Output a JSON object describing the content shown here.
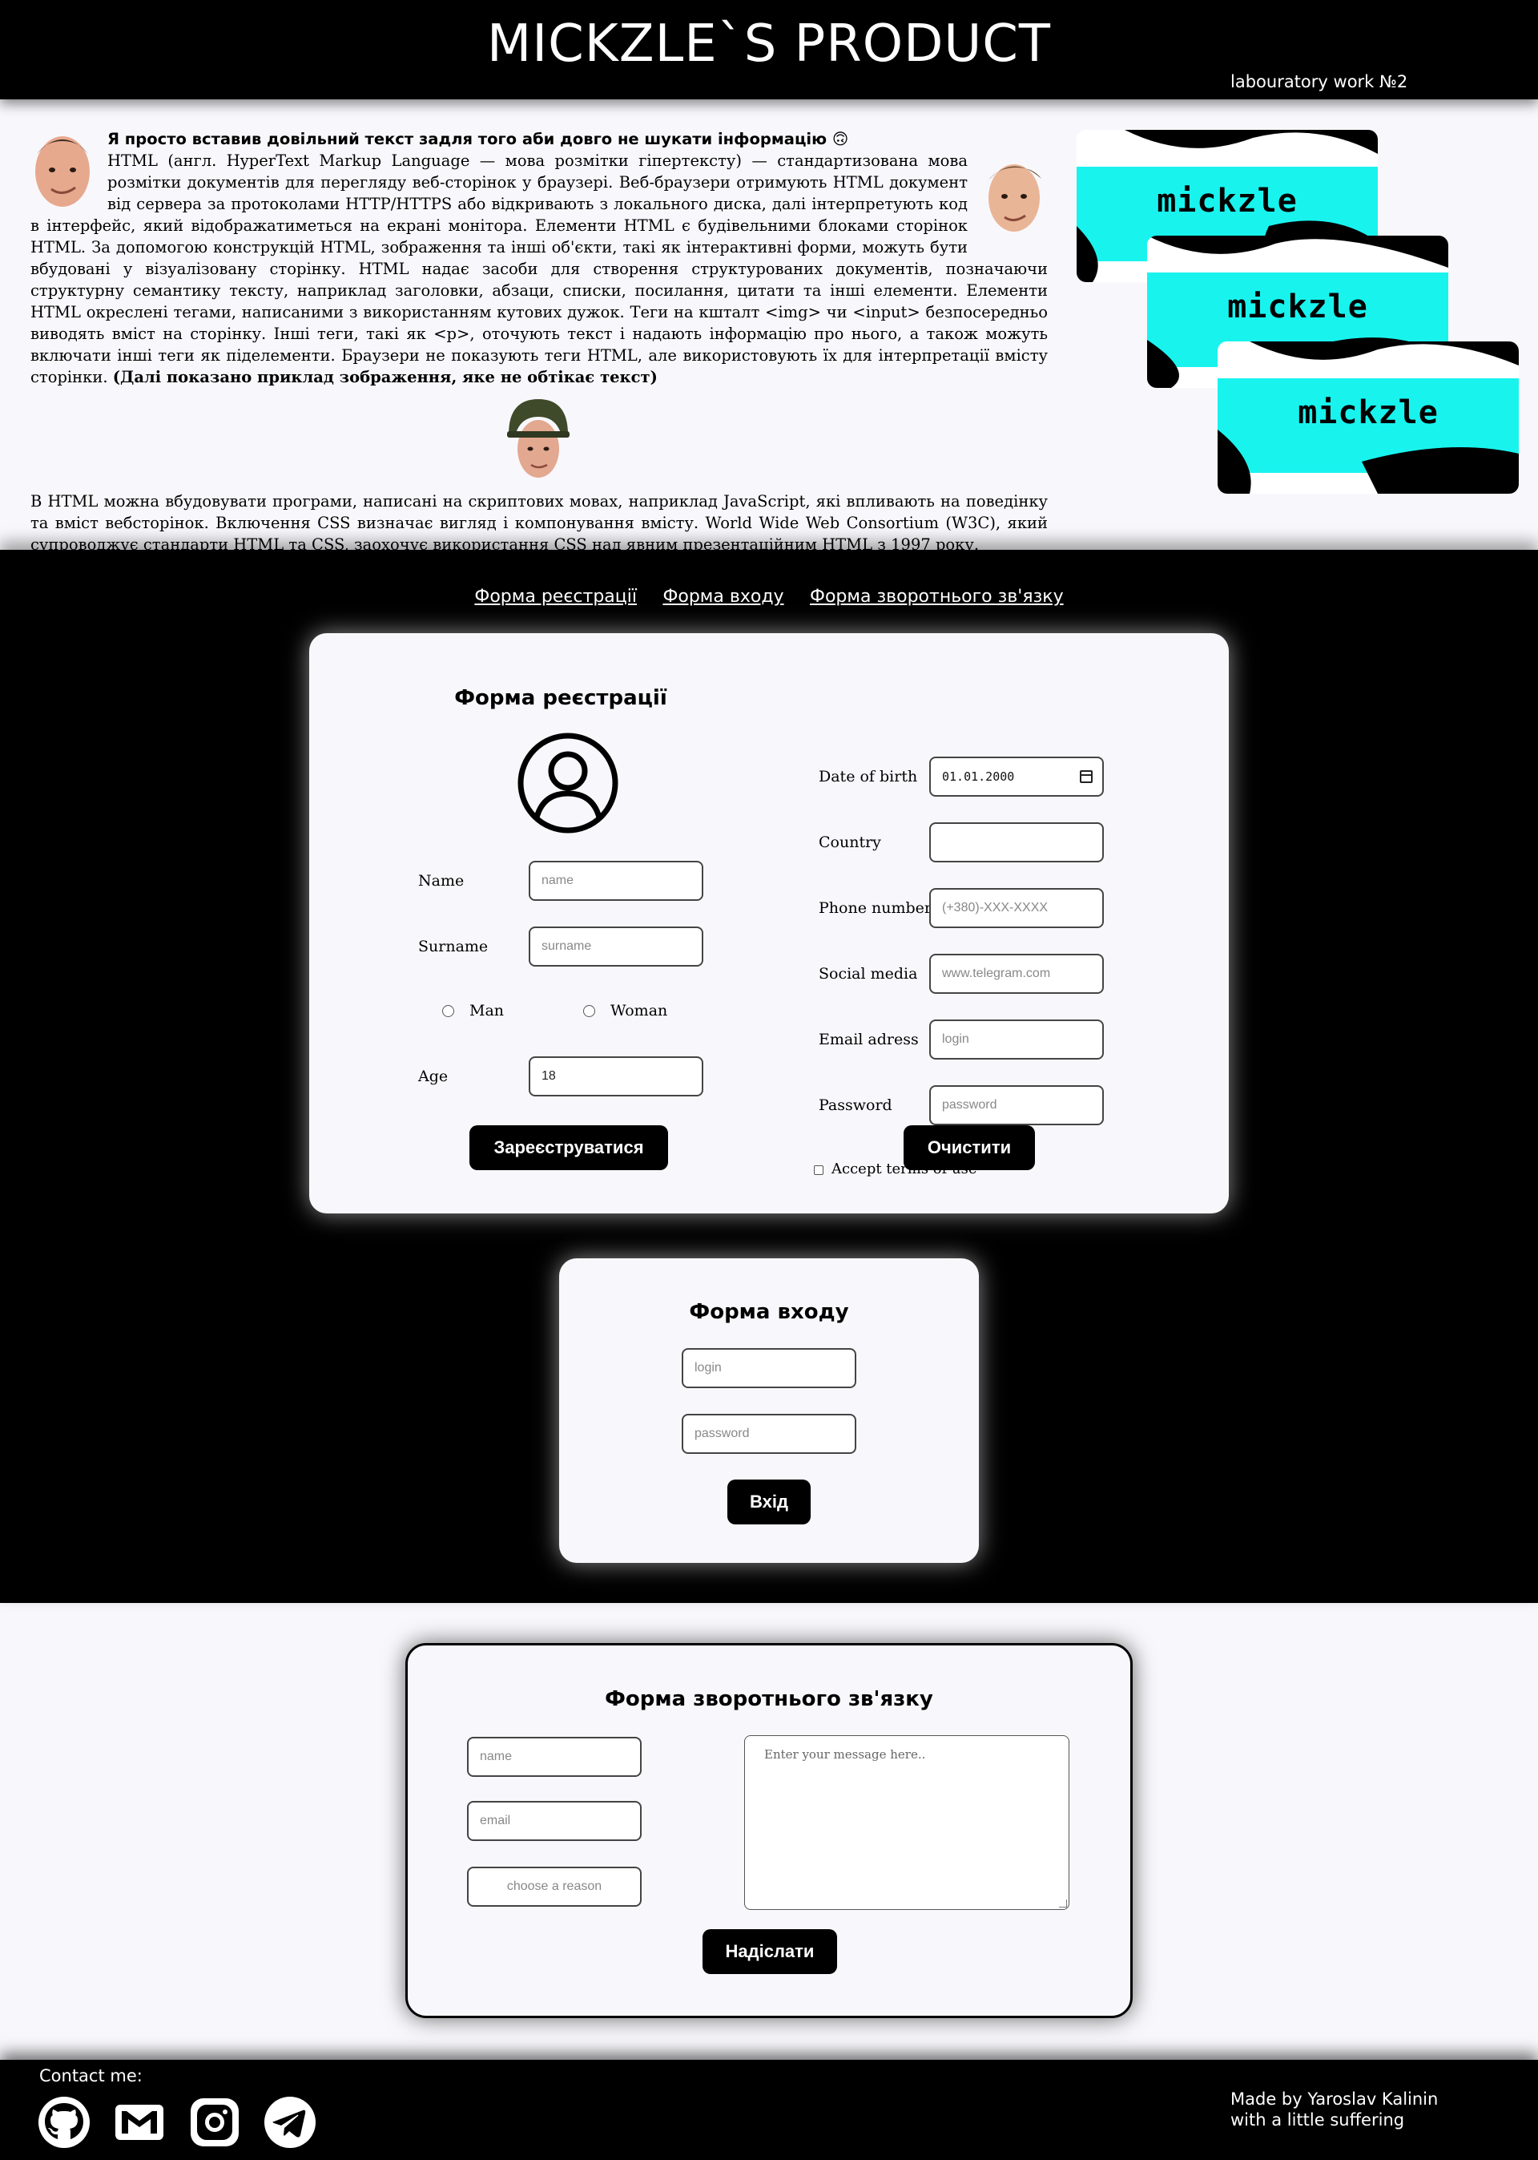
{
  "header": {
    "title": "MICKZLE`S PRODUCT",
    "subtitle": "labouratory work №2"
  },
  "article": {
    "lead": "Я просто вставив довільний текст задля того аби довго не шукати інформацію 🙃",
    "paragraph1": "HTML (англ. HyperText Markup Language — мова розмітки гіпертексту) — стандартизована мова розмітки документів для перегляду веб-сторінок у браузері. Веб-браузери отримують HTML документ від сервера за протоколами HTTP/HTTPS або відкривають з локального диска, далі інтерпретують код в інтерфейс, який відображатиметься на екрані монітора. Елементи HTML є будівельними блоками сторінок HTML. За допомогою конструкцій HTML, зображення та інші об'єкти, такі як інтерактивні форми, можуть бути вбудовані у візуалізовану сторінку. HTML надає засоби для створення структурованих документів, позначаючи структурну семантику тексту, наприклад заголовки, абзаци, списки, посилання, цитати та інші елементи. Елементи HTML окреслені тегами, написаними з використанням кутових дужок. Теги на кшталт <img> чи <input> безпосередньо виводять вміст на сторінку. Інші теги, такі як <p>, оточують текст і надають інформацію про нього, а також можуть включати інші теги як піделементи. Браузери не показують теги HTML, але використовують їх для інтерпретації вмісту сторінки.",
    "paragraph1_bold": "(Далі показано приклад зображення, яке не обтікає текст)",
    "paragraph2": "В HTML можна вбудовувати програми, написані на скриптових мовах, наприклад JavaScript, які впливають на поведінку та вміст вебсторінок. Включення CSS визначає вигляд і компонування вмісту. World Wide Web Consortium (W3C), який супроводжує стандарти HTML та CSS, заохочує використання CSS над явним презентаційним HTML з 1997 року."
  },
  "cards": [
    "mickzle",
    "mickzle",
    "mickzle"
  ],
  "nav": {
    "register": "Форма реєстрації",
    "login": "Форма входу",
    "feedback": "Форма зворотнього зв'язку"
  },
  "register_form": {
    "title": "Форма реєстрації",
    "name_label": "Name",
    "name_placeholder": "name",
    "surname_label": "Surname",
    "surname_placeholder": "surname",
    "gender_man": "Man",
    "gender_woman": "Woman",
    "age_label": "Age",
    "age_value": "18",
    "dob_label": "Date of birth",
    "dob_value": "01.01.2000",
    "country_label": "Country",
    "country_value": "",
    "phone_label": "Phone number",
    "phone_placeholder": "(+380)-XXX-XXXX",
    "social_label": "Social media",
    "social_placeholder": "www.telegram.com",
    "email_label": "Email adress",
    "email_placeholder": "login",
    "password_label": "Password",
    "password_placeholder": "password",
    "terms_label": "Accept terms of use",
    "submit_label": "Зареєструватися",
    "clear_label": "Очистити"
  },
  "login_form": {
    "title": "Форма входу",
    "login_placeholder": "login",
    "password_placeholder": "password",
    "submit_label": "Вхід"
  },
  "feedback_form": {
    "title": "Форма зворотнього зв'язку",
    "name_placeholder": "name",
    "email_placeholder": "email",
    "reason_placeholder": "choose a reason",
    "message_placeholder": "Enter your message here..",
    "submit_label": "Надіслати"
  },
  "footer": {
    "contact_label": "Contact me:",
    "socials": [
      "github-icon",
      "gmail-icon",
      "instagram-icon",
      "telegram-icon"
    ],
    "made_by_line1": "Made by Yaroslav Kalinin",
    "made_by_line2": "with a little suffering"
  },
  "colors": {
    "background": "#f8f8fc",
    "dark": "#000000",
    "card_accent": "#19f3ee"
  }
}
